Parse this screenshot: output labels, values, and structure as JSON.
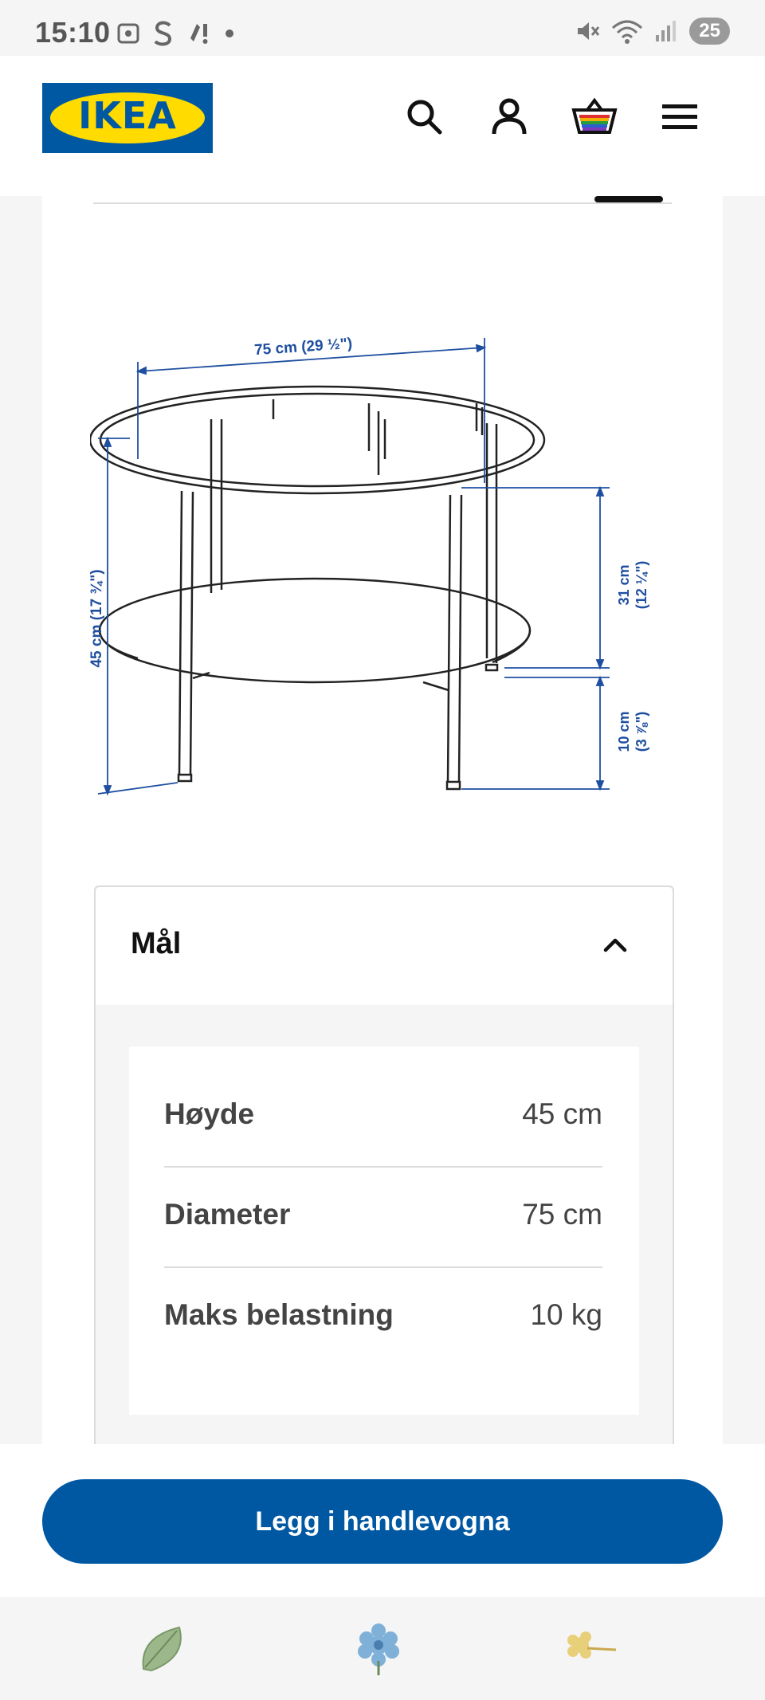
{
  "status_bar": {
    "time": "15:10",
    "battery": "25",
    "left_icons": [
      "screenshot-icon",
      "s-app-icon",
      "notification-icon",
      "dot-icon"
    ],
    "right_icons": [
      "mute-icon",
      "wifi-icon",
      "signal-icon"
    ]
  },
  "header": {
    "logo_text": "IKEA",
    "icons": [
      "search-icon",
      "account-icon",
      "cart-icon",
      "menu-icon"
    ]
  },
  "drawing": {
    "width_label": "75 cm (29 ½\")",
    "height_label": "45 cm (17 ¾\")",
    "shelf_gap_label_1": "31 cm",
    "shelf_gap_label_2": "(12 ¼\")",
    "floor_gap_label_1": "10 cm",
    "floor_gap_label_2": "(3 ⅞\")"
  },
  "accordion": {
    "title": "Mål",
    "expanded": true,
    "rows": [
      {
        "label": "Høyde",
        "value": "45 cm"
      },
      {
        "label": "Diameter",
        "value": "75 cm"
      },
      {
        "label": "Maks belastning",
        "value": "10 kg"
      }
    ]
  },
  "cta": {
    "label": "Legg i handlevogna",
    "color": "#0058a3"
  },
  "bottom_bar": {
    "icons": [
      "leaf-icon",
      "blue-flower-icon",
      "yellow-flower-icon"
    ]
  },
  "colors": {
    "ikea_blue": "#0058a3",
    "ikea_yellow": "#ffdb00",
    "dimension_blue": "#1f4fa0"
  }
}
